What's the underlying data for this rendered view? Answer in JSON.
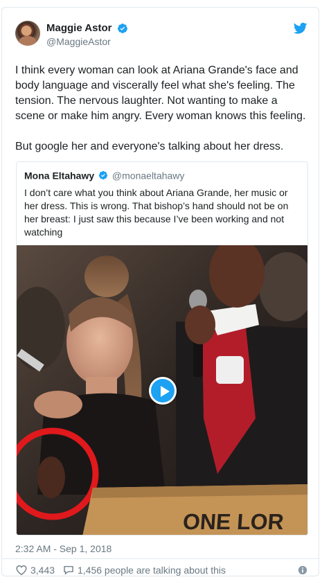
{
  "author": {
    "display_name": "Maggie Astor",
    "handle": "@MaggieAstor"
  },
  "tweet_text": "I think every woman can look at Ariana Grande's face and body language and viscerally feel what she's feeling. The tension. The nervous laughter. Not wanting to make a scene or make him angry. Every woman knows this feeling.\n\nBut google her and everyone's talking about her dress.",
  "quoted_tweet": {
    "display_name": "Mona Eltahawy",
    "handle": "@monaeltahawy",
    "text": "I don’t care what you think about Ariana Grande, her music or her dress. This is wrong. That bishop’s hand should not be on her breast: I just saw this because I’ve been working and not watching",
    "media_sign_text": "ONE LOR"
  },
  "timestamp": "2:32 AM - Sep 1, 2018",
  "likes": "3,443",
  "talking": "1,456 people are talking about this",
  "icons": {
    "verified": "verified-badge-icon",
    "twitter": "twitter-bird-icon",
    "like": "heart-icon",
    "reply": "speech-bubble-icon",
    "info": "info-icon",
    "play": "play-icon"
  },
  "colors": {
    "accent": "#1da1f2",
    "text": "#1c2022",
    "muted": "#697882",
    "border": "#e1e8ed",
    "annotation_circle": "#e0191c"
  }
}
